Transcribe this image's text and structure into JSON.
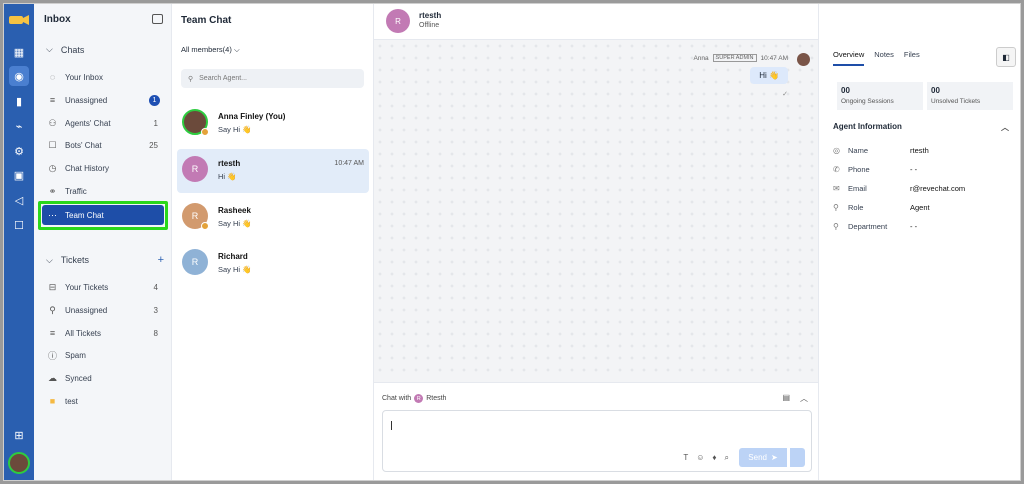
{
  "rail": {
    "icons": [
      "logo-icon",
      "grid-icon",
      "chat-icon",
      "chart-icon",
      "plug-icon",
      "settings-icon",
      "contact-icon",
      "megaphone-icon",
      "bot-icon",
      "gift-icon"
    ]
  },
  "inbox": {
    "title": "Inbox",
    "chats_label": "Chats",
    "chat_items": [
      {
        "label": "Your Inbox",
        "count": ""
      },
      {
        "label": "Unassigned",
        "count": "1"
      },
      {
        "label": "Agents' Chat",
        "count": "1"
      },
      {
        "label": "Bots' Chat",
        "count": "25"
      },
      {
        "label": "Chat History",
        "count": ""
      },
      {
        "label": "Traffic",
        "count": ""
      },
      {
        "label": "Team Chat",
        "count": ""
      }
    ],
    "tickets_label": "Tickets",
    "ticket_items": [
      {
        "label": "Your Tickets",
        "count": "4"
      },
      {
        "label": "Unassigned",
        "count": "3"
      },
      {
        "label": "All Tickets",
        "count": "8"
      },
      {
        "label": "Spam",
        "count": ""
      },
      {
        "label": "Synced",
        "count": ""
      },
      {
        "label": "test",
        "count": ""
      }
    ]
  },
  "team": {
    "title": "Team Chat",
    "members": "All members(4)",
    "search_placeholder": "Search Agent...",
    "chats": [
      {
        "name": "Anna Finley (You)",
        "msg": "Say Hi 👋",
        "time": "",
        "initial": ""
      },
      {
        "name": "rtesth",
        "msg": "Hi 👋",
        "time": "10:47 AM",
        "initial": "R"
      },
      {
        "name": "Rasheek",
        "msg": "Say Hi 👋",
        "time": "",
        "initial": "R"
      },
      {
        "name": "Richard",
        "msg": "Say Hi 👋",
        "time": "",
        "initial": "R"
      }
    ]
  },
  "chat": {
    "contact_initial": "R",
    "contact_name": "rtesth",
    "contact_status": "Offline",
    "sender": "Anna",
    "sender_role": "SUPER ADMIN",
    "message_time": "10:47 AM",
    "message": "Hi 👋",
    "chat_with_label": "Chat with",
    "chat_with_initial": "R",
    "chat_with_name": "Rtesth",
    "send_label": "Send"
  },
  "details": {
    "tabs": [
      "Overview",
      "Notes",
      "Files"
    ],
    "ongoing_value": "00",
    "ongoing_label": "Ongoing Sessions",
    "unsolved_value": "00",
    "unsolved_label": "Unsolved Tickets",
    "section_title": "Agent Information",
    "fields": [
      {
        "label": "Name",
        "value": "rtesth"
      },
      {
        "label": "Phone",
        "value": "- -"
      },
      {
        "label": "Email",
        "value": "r@revechat.com"
      },
      {
        "label": "Role",
        "value": "Agent"
      },
      {
        "label": "Department",
        "value": "- -"
      }
    ]
  }
}
